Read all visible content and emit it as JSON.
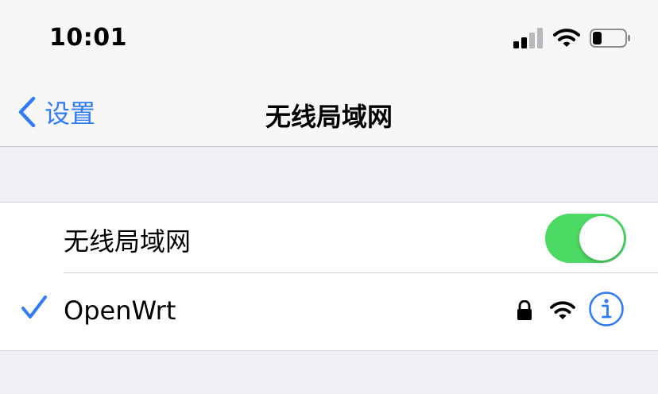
{
  "status_bar": {
    "time": "10:01"
  },
  "nav": {
    "back_label": "设置",
    "title": "无线局域网"
  },
  "wifi_section": {
    "label": "无线局域网",
    "enabled": true
  },
  "network": {
    "name": "OpenWrt",
    "connected": true,
    "secured": true
  },
  "colors": {
    "accent": "#2f7cf6",
    "toggle_on": "#4cd964"
  },
  "icons": [
    "signal-icon",
    "wifi-status-icon",
    "battery-icon",
    "chevron-left-icon",
    "checkmark-icon",
    "lock-icon",
    "wifi-signal-icon",
    "info-icon"
  ]
}
